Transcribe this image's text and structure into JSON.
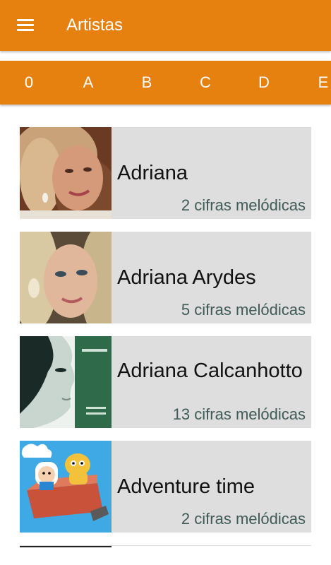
{
  "app_bar": {
    "title": "Artistas",
    "menu_icon": "hamburger-menu-icon"
  },
  "letter_tabs": [
    "0",
    "A",
    "B",
    "C",
    "D",
    "E"
  ],
  "artists": [
    {
      "name": "Adriana",
      "count": "2 cifras melódicas"
    },
    {
      "name": "Adriana Arydes",
      "count": "5 cifras melódicas"
    },
    {
      "name": "Adriana Calcanhotto",
      "count": "13 cifras melódicas"
    },
    {
      "name": "Adventure time",
      "count": "2 cifras melódicas"
    }
  ],
  "colors": {
    "accent": "#E6800E",
    "card": "#DEDEDE",
    "count_text": "#3F5A57"
  }
}
